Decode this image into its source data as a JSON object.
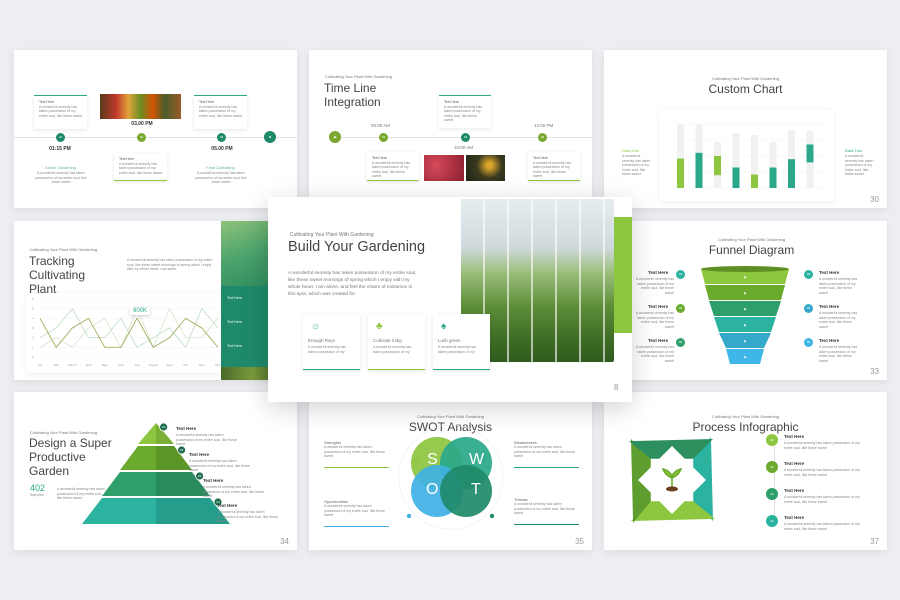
{
  "colors": {
    "green": "#8dc63f",
    "teal": "#2aa889",
    "darkGreen": "#1f8a6a",
    "blue": "#3fb1e5",
    "olive": "#7aa82f"
  },
  "common": {
    "subtitle": "Cultivating Your Plant With Gardening",
    "text_here": "Text Here",
    "lorem": "A wonderful serenity has taken possession of my entire soul, like these sweet"
  },
  "timeline_a": {
    "times": [
      "01:15 PM",
      "03.00 PM",
      "05.00 PM"
    ],
    "labels": [
      "Action Gardening",
      "Final Cultivating"
    ],
    "steps": [
      "01",
      "02",
      "03"
    ]
  },
  "timeline_b": {
    "title": "Time Line Integration",
    "times": [
      "00:00 AM",
      "10:00 AM",
      "12:00 PM"
    ],
    "steps": [
      "01",
      "02",
      "03"
    ]
  },
  "custom_chart": {
    "title": "Custom Chart",
    "page": "30",
    "left_label": "Data One",
    "right_label": "Data Two",
    "bars": [
      {
        "color": "green",
        "from": 0,
        "to": 46,
        "track": 100
      },
      {
        "color": "teal",
        "from": 0,
        "to": 55,
        "track": 100
      },
      {
        "color": "green",
        "from": 20,
        "to": 50,
        "track": 72
      },
      {
        "color": "teal",
        "from": 0,
        "to": 32,
        "track": 86
      },
      {
        "color": "green",
        "from": 0,
        "to": 21,
        "track": 83
      },
      {
        "color": "teal",
        "from": 0,
        "to": 32,
        "track": 72
      },
      {
        "color": "teal",
        "from": 0,
        "to": 45,
        "track": 90
      },
      {
        "color": "teal",
        "from": 40,
        "to": 68,
        "track": 90
      }
    ]
  },
  "tracking": {
    "title_lines": [
      "Tracking",
      "Cultivating",
      "Plant"
    ],
    "paragraph": "A wonderful serenity has taken possession of my entire soul, like these sweet mornings of spring which I enjoy with my whole heart. I am alone.",
    "callout": "900K",
    "chart_data": {
      "type": "line",
      "categories": [
        "Jan",
        "Feb",
        "March",
        "April",
        "May",
        "June",
        "July",
        "August",
        "Sept",
        "Oct",
        "Nov",
        "Dec"
      ],
      "ylim": [
        0,
        6
      ],
      "yticks": [
        0,
        1,
        2,
        3,
        4,
        5,
        6
      ],
      "series": [
        {
          "values": [
            4,
            1,
            3,
            4,
            1,
            1,
            4,
            1,
            2,
            4,
            3,
            1
          ],
          "color": "#a3ad5a"
        },
        {
          "values": [
            2,
            3,
            5,
            2,
            2,
            4,
            1,
            2,
            3,
            1,
            5,
            3
          ],
          "color": "#c6e0c8"
        },
        {
          "values": [
            1,
            2,
            1,
            3,
            4,
            1,
            5,
            1,
            5,
            2,
            2,
            4
          ],
          "color": "#d6ead0"
        }
      ]
    },
    "panel_items": [
      "Text Here",
      "Text Here",
      "Text Here"
    ]
  },
  "build": {
    "title": "Build Your Gardening",
    "page": "8",
    "paragraph": "A wonderful serenity has taken possession of my entire soul, like these sweet mornings of spring which I enjoy with my whole heart. I am alone, and feel the charm of existence in this spot, which was created for.",
    "cards": [
      {
        "icon": "sun-icon",
        "label": "Enough Rays",
        "text": "A wonderful serenity has taken possession of my",
        "bar": "#2aa889"
      },
      {
        "icon": "sprout-pot-icon",
        "label": "Cultivate it Big",
        "text": "A wonderful serenity has taken possession of my",
        "bar": "#8dc63f"
      },
      {
        "icon": "tree-icon",
        "label": "Lush green",
        "text": "A wonderful serenity has taken possession of my",
        "bar": "#2aa889"
      }
    ]
  },
  "funnel": {
    "title": "Funnel Diagram",
    "page": "33",
    "left_steps": [
      "01",
      "02",
      "03"
    ],
    "right_steps": [
      "04",
      "05",
      "06"
    ],
    "layers": [
      "#8dc63f",
      "#6aab2e",
      "#2e9e6a",
      "#2bb3a0",
      "#35a9c9",
      "#3fb6e8"
    ]
  },
  "pyramid": {
    "title_lines": [
      "Design a Super",
      "Productive",
      "Garden"
    ],
    "stat": "402",
    "stat_label": "Samples",
    "page": "34",
    "steps": [
      "01",
      "02",
      "03",
      "04"
    ]
  },
  "swot": {
    "title": "SWOT Analysis",
    "page": "35",
    "letters": [
      "S",
      "W",
      "O",
      "T"
    ],
    "boxes": [
      "Strengths",
      "Weaknesses",
      "Opportunities",
      "Threats"
    ]
  },
  "process": {
    "title": "Process Infographic",
    "page": "37",
    "steps": [
      "01",
      "02",
      "03",
      "04"
    ]
  }
}
